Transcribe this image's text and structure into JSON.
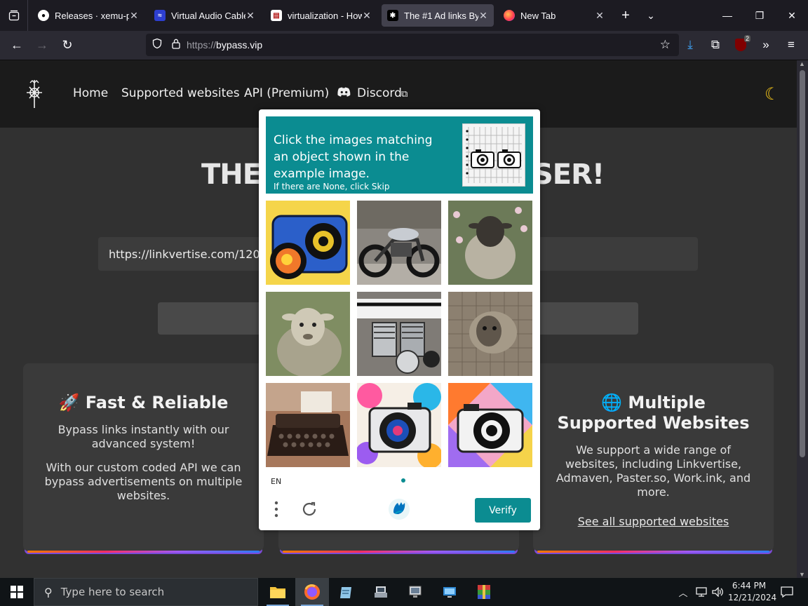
{
  "browser": {
    "tabs": [
      {
        "title": "Releases · xemu-proj",
        "favicon": "github-icon"
      },
      {
        "title": "Virtual Audio Cable -",
        "favicon": "vac-icon"
      },
      {
        "title": "virtualization - How a",
        "favicon": "superuser-icon"
      },
      {
        "title": "The #1 Ad links Bypa",
        "favicon": "bypass-icon",
        "active": true
      },
      {
        "title": "New Tab",
        "favicon": "firefox-icon"
      }
    ],
    "url_scheme": "https://",
    "url_host": "bypass.vip",
    "extension_badge": "2"
  },
  "site": {
    "nav": [
      "Home",
      "Supported websites",
      "API (Premium)",
      "Discord"
    ],
    "hero_left": "THE",
    "hero_right": "SER!",
    "link_value": "https://linkvertise.com/12081",
    "cards": [
      {
        "emoji": "🚀",
        "title": "Fast & Reliable",
        "p1": "Bypass links instantly with our advanced system!",
        "p2": "With our custom coded API we can bypass advertisements on multiple websites."
      },
      {
        "emoji": "🌐",
        "title": "Multiple Supported Websites",
        "p1": "We support a wide range of websites, including Linkvertise, Admaven, Paster.so, Work.ink, and more.",
        "link": "See all supported websites"
      }
    ]
  },
  "captcha": {
    "instruction": "Click the images matching an object shown in the example image.",
    "sub": "If there are None, click Skip",
    "language": "EN",
    "verify_label": "Verify",
    "images": [
      "camera-image",
      "motorcycle-image",
      "sheep-image",
      "sheep-image",
      "motorcycle-engine-image",
      "sheep-image",
      "typewriter-image",
      "camera-image",
      "camera-image"
    ]
  },
  "taskbar": {
    "search_placeholder": "Type here to search",
    "time": "6:44 PM",
    "date": "12/21/2024"
  },
  "colors": {
    "teal": "#0b8c91",
    "page_bg": "#313131",
    "header_bg": "#1b1b1b"
  }
}
